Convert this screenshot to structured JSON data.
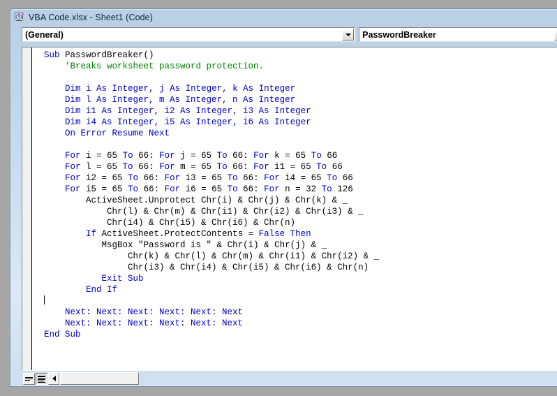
{
  "window": {
    "title": "VBA Code.xlsx - Sheet1 (Code)",
    "icon": "vba-module-icon",
    "frame_color": "#b9cfe4",
    "desktop_color": "#a6a6a6"
  },
  "toolbar": {
    "object_combo": {
      "name": "object-dropdown",
      "value": "(General)",
      "arrow_icon": "chevron-down-icon"
    },
    "procedure_combo": {
      "name": "procedure-dropdown",
      "value": "PasswordBreaker",
      "arrow_icon": "chevron-down-icon"
    }
  },
  "editor": {
    "colors": {
      "keyword": "#0000c0",
      "comment": "#008000",
      "identifier": "#000000",
      "background": "#ffffff",
      "margin": "#f1f1f1"
    },
    "caret_line_index": 26,
    "lines": [
      [
        {
          "t": "  ",
          "c": "idn"
        },
        {
          "t": "Sub ",
          "c": "kw"
        },
        {
          "t": "PasswordBreaker()",
          "c": "idn"
        }
      ],
      [
        {
          "t": "      ",
          "c": "idn"
        },
        {
          "t": "'Breaks worksheet password protection.",
          "c": "cmt"
        }
      ],
      [
        {
          "t": "",
          "c": "idn"
        }
      ],
      [
        {
          "t": "      ",
          "c": "idn"
        },
        {
          "t": "Dim ",
          "c": "kw"
        },
        {
          "t": "i ",
          "c": "kw"
        },
        {
          "t": "As Integer, ",
          "c": "kw"
        },
        {
          "t": "j ",
          "c": "kw"
        },
        {
          "t": "As Integer, ",
          "c": "kw"
        },
        {
          "t": "k ",
          "c": "kw"
        },
        {
          "t": "As Integer",
          "c": "kw"
        }
      ],
      [
        {
          "t": "      ",
          "c": "idn"
        },
        {
          "t": "Dim l As Integer, m As Integer, n As Integer",
          "c": "kw"
        }
      ],
      [
        {
          "t": "      ",
          "c": "idn"
        },
        {
          "t": "Dim i1 As Integer, i2 As Integer, i3 As Integer",
          "c": "kw"
        }
      ],
      [
        {
          "t": "      ",
          "c": "idn"
        },
        {
          "t": "Dim i4 As Integer, i5 As Integer, i6 As Integer",
          "c": "kw"
        }
      ],
      [
        {
          "t": "      ",
          "c": "idn"
        },
        {
          "t": "On Error Resume Next",
          "c": "kw"
        }
      ],
      [
        {
          "t": "",
          "c": "idn"
        }
      ],
      [
        {
          "t": "      ",
          "c": "idn"
        },
        {
          "t": "For ",
          "c": "kw"
        },
        {
          "t": "i = ",
          "c": "idn"
        },
        {
          "t": "65 ",
          "c": "idn"
        },
        {
          "t": "To ",
          "c": "kw"
        },
        {
          "t": "66: ",
          "c": "idn"
        },
        {
          "t": "For ",
          "c": "kw"
        },
        {
          "t": "j = 65 ",
          "c": "idn"
        },
        {
          "t": "To ",
          "c": "kw"
        },
        {
          "t": "66: ",
          "c": "idn"
        },
        {
          "t": "For ",
          "c": "kw"
        },
        {
          "t": "k = 65 ",
          "c": "idn"
        },
        {
          "t": "To ",
          "c": "kw"
        },
        {
          "t": "66",
          "c": "idn"
        }
      ],
      [
        {
          "t": "      ",
          "c": "idn"
        },
        {
          "t": "For ",
          "c": "kw"
        },
        {
          "t": "l = 65 ",
          "c": "idn"
        },
        {
          "t": "To ",
          "c": "kw"
        },
        {
          "t": "66: ",
          "c": "idn"
        },
        {
          "t": "For ",
          "c": "kw"
        },
        {
          "t": "m = 65 ",
          "c": "idn"
        },
        {
          "t": "To ",
          "c": "kw"
        },
        {
          "t": "66: ",
          "c": "idn"
        },
        {
          "t": "For ",
          "c": "kw"
        },
        {
          "t": "i1 = 65 ",
          "c": "idn"
        },
        {
          "t": "To ",
          "c": "kw"
        },
        {
          "t": "66",
          "c": "idn"
        }
      ],
      [
        {
          "t": "      ",
          "c": "idn"
        },
        {
          "t": "For ",
          "c": "kw"
        },
        {
          "t": "i2 = 65 ",
          "c": "idn"
        },
        {
          "t": "To ",
          "c": "kw"
        },
        {
          "t": "66: ",
          "c": "idn"
        },
        {
          "t": "For ",
          "c": "kw"
        },
        {
          "t": "i3 = 65 ",
          "c": "idn"
        },
        {
          "t": "To ",
          "c": "kw"
        },
        {
          "t": "66: ",
          "c": "idn"
        },
        {
          "t": "For ",
          "c": "kw"
        },
        {
          "t": "i4 = 65 ",
          "c": "idn"
        },
        {
          "t": "To ",
          "c": "kw"
        },
        {
          "t": "66",
          "c": "idn"
        }
      ],
      [
        {
          "t": "      ",
          "c": "idn"
        },
        {
          "t": "For ",
          "c": "kw"
        },
        {
          "t": "i5 = 65 ",
          "c": "idn"
        },
        {
          "t": "To ",
          "c": "kw"
        },
        {
          "t": "66: ",
          "c": "idn"
        },
        {
          "t": "For ",
          "c": "kw"
        },
        {
          "t": "i6 = 65 ",
          "c": "idn"
        },
        {
          "t": "To ",
          "c": "kw"
        },
        {
          "t": "66: ",
          "c": "idn"
        },
        {
          "t": "For ",
          "c": "kw"
        },
        {
          "t": "n = 32 ",
          "c": "idn"
        },
        {
          "t": "To ",
          "c": "kw"
        },
        {
          "t": "126",
          "c": "idn"
        }
      ],
      [
        {
          "t": "          ActiveSheet.Unprotect Chr(i) & Chr(j) & Chr(k) & _",
          "c": "idn"
        }
      ],
      [
        {
          "t": "              Chr(l) & Chr(m) & Chr(i1) & Chr(i2) & Chr(i3) & _",
          "c": "idn"
        }
      ],
      [
        {
          "t": "              Chr(i4) & Chr(i5) & Chr(i6) & Chr(n)",
          "c": "idn"
        }
      ],
      [
        {
          "t": "          ",
          "c": "idn"
        },
        {
          "t": "If ",
          "c": "kw"
        },
        {
          "t": "ActiveSheet.ProtectContents = ",
          "c": "idn"
        },
        {
          "t": "False Then",
          "c": "kw"
        }
      ],
      [
        {
          "t": "             MsgBox ",
          "c": "idn"
        },
        {
          "t": "\"Password is \"",
          "c": "idn"
        },
        {
          "t": " & Chr(i) & Chr(j) & _",
          "c": "idn"
        }
      ],
      [
        {
          "t": "                  Chr(k) & Chr(l) & Chr(m) & Chr(i1) & Chr(i2) & _",
          "c": "idn"
        }
      ],
      [
        {
          "t": "                  Chr(i3) & Chr(i4) & Chr(i5) & Chr(i6) & Chr(n)",
          "c": "idn"
        }
      ],
      [
        {
          "t": "             ",
          "c": "idn"
        },
        {
          "t": "Exit Sub",
          "c": "kw"
        }
      ],
      [
        {
          "t": "          ",
          "c": "idn"
        },
        {
          "t": "End If",
          "c": "kw"
        }
      ],
      [
        {
          "t": "",
          "c": "idn"
        }
      ],
      [
        {
          "t": "      ",
          "c": "idn"
        },
        {
          "t": "Next: Next: Next: Next: Next: Next",
          "c": "kw"
        }
      ],
      [
        {
          "t": "      ",
          "c": "idn"
        },
        {
          "t": "Next: Next: Next: Next: Next: Next",
          "c": "kw"
        }
      ],
      [
        {
          "t": "  ",
          "c": "idn"
        },
        {
          "t": "End Sub",
          "c": "kw"
        }
      ]
    ]
  },
  "bottom_bar": {
    "procedure_view_button": {
      "name": "procedure-view-button",
      "icon": "procedure-view-icon",
      "active": false
    },
    "full_module_view_button": {
      "name": "full-module-view-button",
      "icon": "full-module-view-icon",
      "active": true
    },
    "hscrollbar": {
      "name": "horizontal-scrollbar",
      "left_arrow_icon": "arrow-left-icon"
    }
  }
}
